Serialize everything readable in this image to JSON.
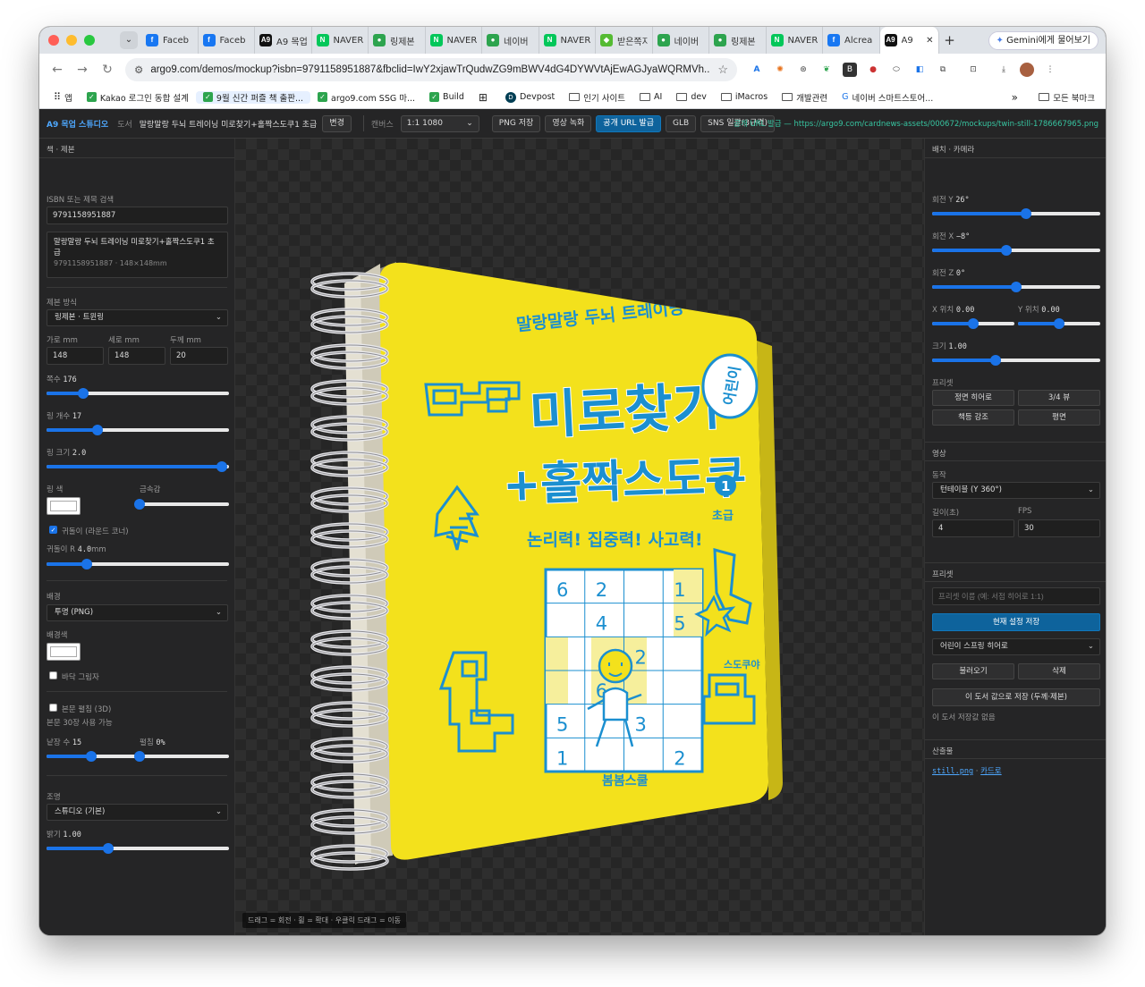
{
  "browser": {
    "tabs": [
      {
        "icon": "facebook-icon",
        "label": "Faceb",
        "color": "#1877f2",
        "glyph": "f"
      },
      {
        "icon": "facebook-icon",
        "label": "Faceb",
        "color": "#1877f2",
        "glyph": "f"
      },
      {
        "icon": "a9-icon",
        "label": "A9 목업",
        "color": "#111",
        "glyph": "A9"
      },
      {
        "icon": "naver-icon",
        "label": "NAVER",
        "color": "#03c75a",
        "glyph": "N"
      },
      {
        "icon": "leaf-icon",
        "label": "링제본",
        "color": "#2da44e",
        "glyph": "●"
      },
      {
        "icon": "naver-icon",
        "label": "NAVER",
        "color": "#03c75a",
        "glyph": "N"
      },
      {
        "icon": "leaf-icon",
        "label": "네이버",
        "color": "#2da44e",
        "glyph": "●"
      },
      {
        "icon": "naver-icon",
        "label": "NAVER",
        "color": "#03c75a",
        "glyph": "N"
      },
      {
        "icon": "puzzle-icon",
        "label": "받은쪽지",
        "color": "#5b3",
        "glyph": "◆"
      },
      {
        "icon": "bell-icon",
        "label": "네이버",
        "color": "#2da44e",
        "glyph": "●"
      },
      {
        "icon": "leaf-icon",
        "label": "링제본",
        "color": "#2da44e",
        "glyph": "●"
      },
      {
        "icon": "naver-icon",
        "label": "NAVER",
        "color": "#03c75a",
        "glyph": "N"
      },
      {
        "icon": "facebook-icon",
        "label": "Alcrea",
        "color": "#1877f2",
        "glyph": "f"
      },
      {
        "icon": "a9-icon",
        "label": "A9",
        "color": "#111",
        "glyph": "A9",
        "active": true
      }
    ],
    "gemini_label": "Gemini에게 물어보기",
    "url": "argo9.com/demos/mockup?isbn=9791158951887&fbclid=IwY2xjawTrQudwZG9mBWV4dG4DYWVtAjEwAGJyaWQRMVh...",
    "bookmarks": [
      {
        "label": "앱",
        "kind": "apps"
      },
      {
        "label": "Kakao 로그인 동합 설계",
        "kind": "check"
      },
      {
        "label": "9월 신간 퍼즐 책 출판...",
        "kind": "check",
        "hl": true
      },
      {
        "label": "argo9.com SSG 마...",
        "kind": "check"
      },
      {
        "label": "Build",
        "kind": "check"
      },
      {
        "label": "",
        "kind": "grid"
      },
      {
        "label": "Devpost",
        "kind": "dev"
      },
      {
        "label": "인기 사이트",
        "kind": "folder"
      },
      {
        "label": "AI",
        "kind": "folder"
      },
      {
        "label": "dev",
        "kind": "folder"
      },
      {
        "label": "iMacros",
        "kind": "folder"
      },
      {
        "label": "개발관련",
        "kind": "folder"
      },
      {
        "label": "네이버 스마트스토어...",
        "kind": "g"
      }
    ],
    "bookmarks_more": "»",
    "all_bookmarks": "모든 북마크"
  },
  "app": {
    "brand": "A9 목업 스튜디오",
    "book_label": "도서",
    "book_title": "말랑말랑 두뇌 트레이닝 미로찾기+홀짝스도쿠1 초급",
    "change_button": "변경",
    "canvas_label": "캔버스",
    "canvas_value": "1:1 1080",
    "png_button": "PNG 저장",
    "video_button": "영상 녹화",
    "publish_button": "공개 URL 발급",
    "glb_button": "GLB",
    "sns_button": "SNS 일괄(3규격)",
    "publish_info": "공개 URL 발급 — https://argo9.com/cardnews-assets/000672/mockups/twin-still-1786667965.png"
  },
  "left": {
    "section": "책 · 제본",
    "isbn_label": "ISBN 또는 제목 검색",
    "isbn_value": "9791158951887",
    "result_title_1": "말랑말랑 두뇌 트레이닝 미로찾기+홀짝스도쿠1 초",
    "result_title_2": "급",
    "result_meta": "9791158951887 · 148×148mm",
    "binding_label": "제본 방식",
    "binding_value": "링제본 · 트윈링",
    "width_label": "가로 mm",
    "width_value": "148",
    "height_label": "세로 mm",
    "height_value": "148",
    "thickness_label": "두께 mm",
    "thickness_value": "20",
    "pages_label": "쪽수",
    "pages_value": "176",
    "pages_level": 0.2,
    "rings_label": "링 개수",
    "rings_value": "17",
    "rings_level": 0.28,
    "ringsize_label": "링 크기",
    "ringsize_value": "2.0",
    "ringsize_level": 0.96,
    "ringcolor_label": "링 색",
    "metal_label": "금속감",
    "metal_level": 0.0,
    "round_label": "귀돌이 (라운드 코너)",
    "radius_label": "귀돌이 R",
    "radius_value": "4.0",
    "radius_unit": "mm",
    "radius_level": 0.22,
    "bg_label": "배경",
    "bg_value": "투명 (PNG)",
    "bgcolor_label": "배경색",
    "shadow_label": "바닥 그림자",
    "spread_label": "본문 펼침 (3D)",
    "spread_note": "본문 30장 사용 가능",
    "sheets_label": "낱장 수",
    "sheets_value": "15",
    "sheets_level": 0.5,
    "open_label": "펼침",
    "open_value": "0%",
    "open_level": 0.0,
    "light_label": "조명",
    "light_value": "스튜디오 (기본)",
    "bright_label": "밝기",
    "bright_value": "1.00",
    "bright_level": 0.34
  },
  "canvas": {
    "hint": "드래그 = 회전 · 휠 = 확대 · 우클릭 드래그 = 이동",
    "cover": {
      "top_line": "말랑말랑 두뇌 트레이닝",
      "badge": "어린이",
      "title_1": "미로찾기",
      "title_2": "+홀짝스도쿠",
      "volume": "1",
      "level": "초급",
      "tagline": "논리력! 집중력! 사고력!",
      "side_text": "스도쿠야",
      "publisher": "봄봄스쿨",
      "bg_color": "#f3e11c",
      "title_color": "#1b8fd0",
      "sudoku": [
        [
          "6",
          "2",
          "",
          "1"
        ],
        [
          "",
          "4",
          "",
          "5"
        ],
        [
          "",
          "",
          "2",
          ""
        ],
        [
          "",
          "6",
          "",
          ""
        ],
        [
          "5",
          "",
          "3",
          ""
        ],
        [
          "1",
          "",
          "",
          "2"
        ]
      ]
    }
  },
  "right": {
    "section": "배치 · 카메라",
    "roty_label": "회전 Y",
    "roty_value": "26°",
    "roty_level": 0.56,
    "rotx_label": "회전 X",
    "rotx_value": "−8°",
    "rotx_level": 0.44,
    "rotz_label": "회전 Z",
    "rotz_value": "0°",
    "rotz_level": 0.5,
    "posx_label": "X 위치",
    "posx_value": "0.00",
    "posx_level": 0.5,
    "posy_label": "Y 위치",
    "posy_value": "0.00",
    "posy_level": 0.5,
    "scale_label": "크기",
    "scale_value": "1.00",
    "scale_level": 0.38,
    "preset_label": "프리셋",
    "preset_front": "정면 히어로",
    "preset_34": "3/4 뷰",
    "preset_spine": "책등 강조",
    "preset_flat": "평면",
    "video_section": "영상",
    "motion_label": "동작",
    "motion_value": "턴테이블 (Y 360°)",
    "length_label": "길이(초)",
    "length_value": "4",
    "fps_label": "FPS",
    "fps_value": "30",
    "preset_section": "프리셋",
    "preset_name_placeholder": "프리셋 이름 (예: 서점 히어로 1:1)",
    "save_current": "현재 설정 저장",
    "preset_select": "어린이 스프링 히어로",
    "load_button": "불러오기",
    "delete_button": "삭제",
    "save_book": "이 도서 값으로 저장 (두께·제본)",
    "no_saved": "이 도서 저장값 없음",
    "output_section": "산출물",
    "output_file": "still.png",
    "output_sep": "·",
    "output_card": "카드로"
  }
}
